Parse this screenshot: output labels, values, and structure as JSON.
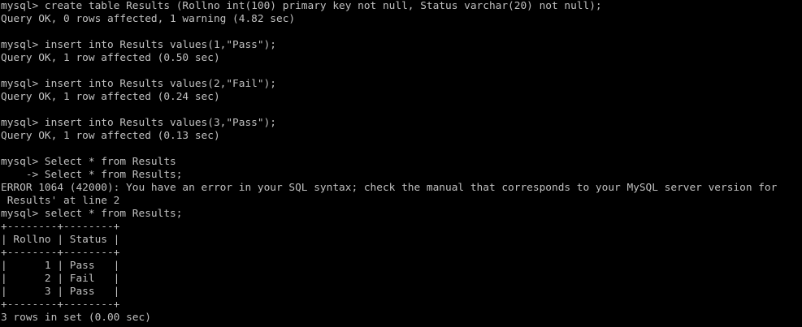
{
  "terminal": {
    "lines": [
      "mysql> create table Results (Rollno int(100) primary key not null, Status varchar(20) not null);",
      "Query OK, 0 rows affected, 1 warning (4.82 sec)",
      "",
      "mysql> insert into Results values(1,\"Pass\");",
      "Query OK, 1 row affected (0.50 sec)",
      "",
      "mysql> insert into Results values(2,\"Fail\");",
      "Query OK, 1 row affected (0.24 sec)",
      "",
      "mysql> insert into Results values(3,\"Pass\");",
      "Query OK, 1 row affected (0.13 sec)",
      "",
      "mysql> Select * from Results",
      "    -> Select * from Results;",
      "ERROR 1064 (42000): You have an error in your SQL syntax; check the manual that corresponds to your MySQL server version for",
      " Results' at line 2",
      "mysql> select * from Results;",
      "+--------+--------+",
      "| Rollno | Status |",
      "+--------+--------+",
      "|      1 | Pass   |",
      "|      2 | Fail   |",
      "|      3 | Pass   |",
      "+--------+--------+",
      "3 rows in set (0.00 sec)"
    ]
  }
}
